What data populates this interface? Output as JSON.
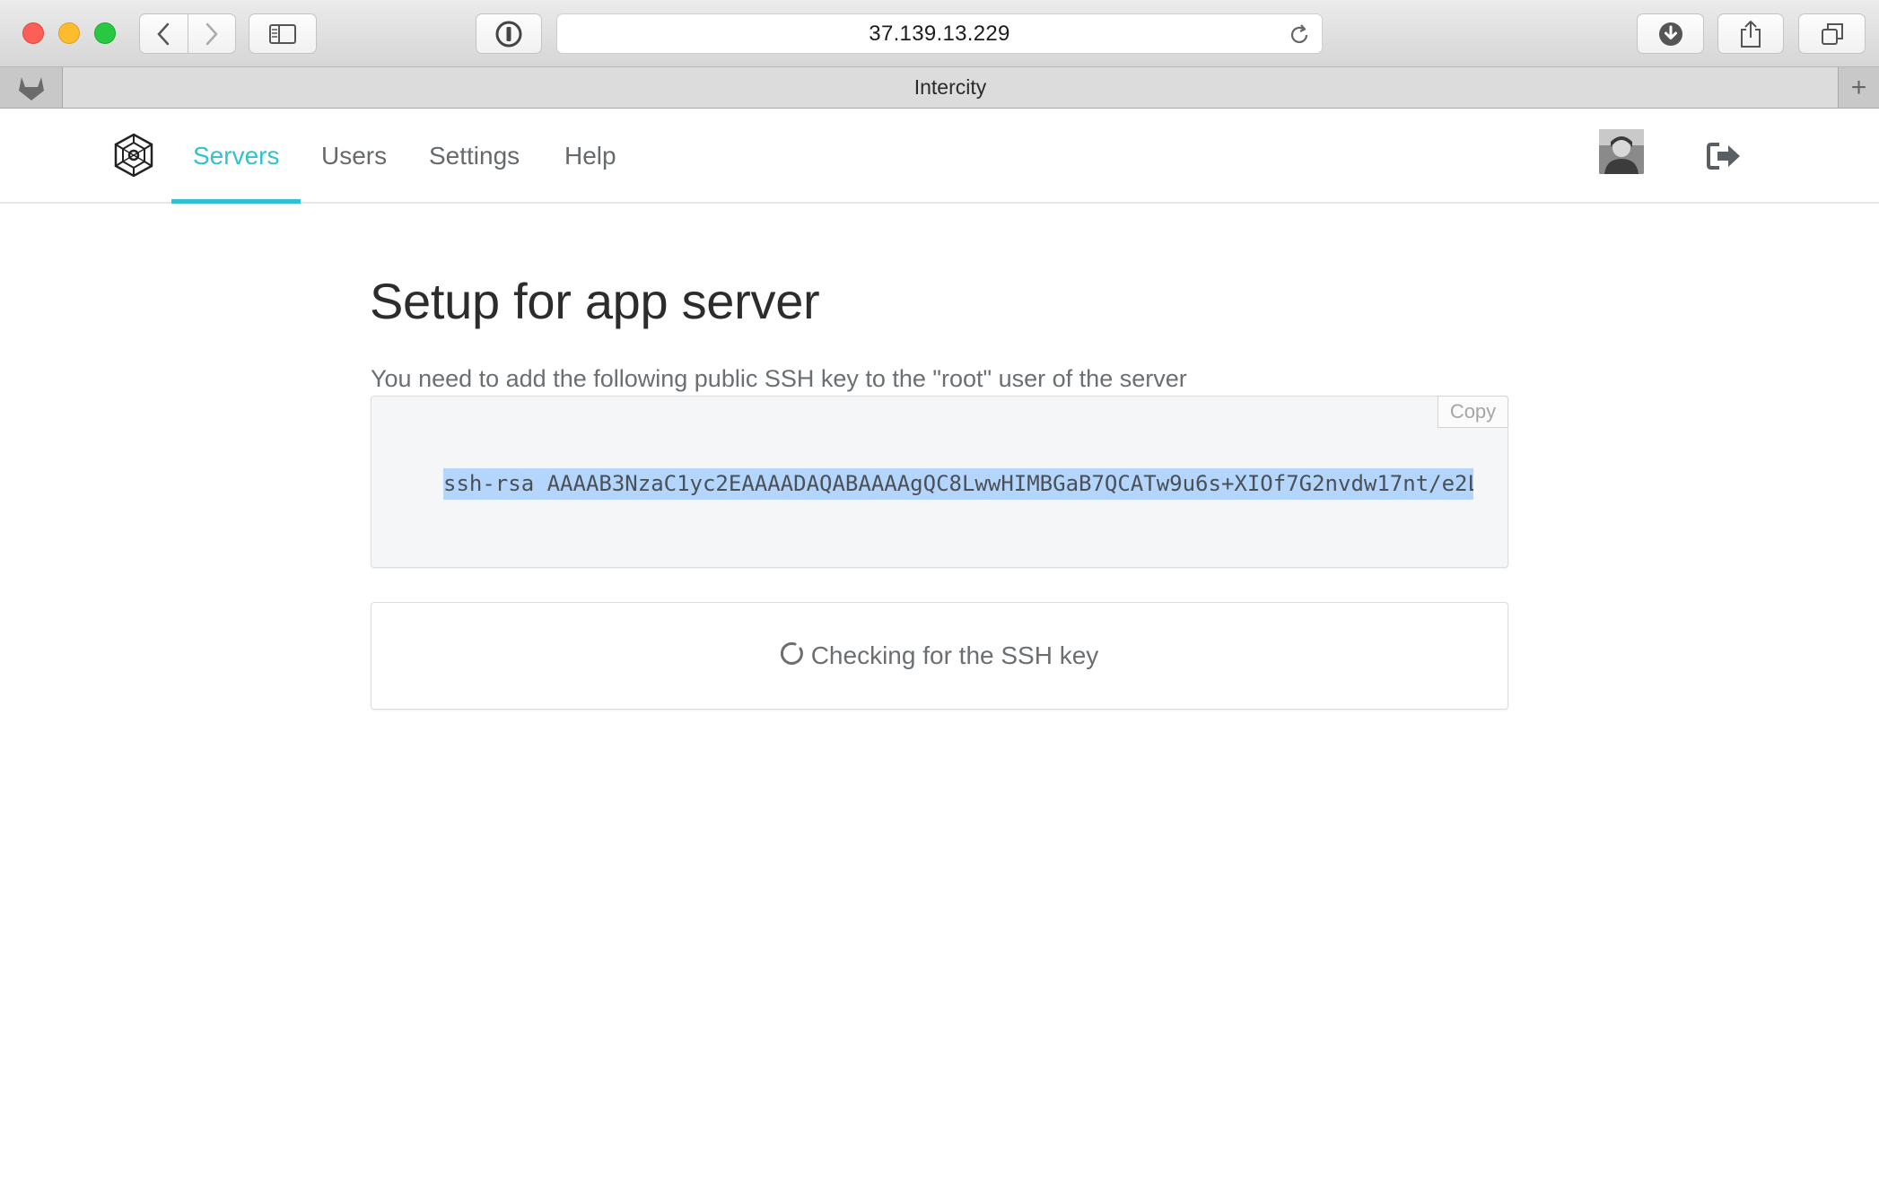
{
  "browser": {
    "url": "37.139.13.229",
    "tab_title": "Intercity",
    "new_tab_label": "+"
  },
  "nav": {
    "items": [
      {
        "label": "Servers",
        "active": true
      },
      {
        "label": "Users",
        "active": false
      },
      {
        "label": "Settings",
        "active": false
      },
      {
        "label": "Help",
        "active": false
      }
    ],
    "accent_color": "#33c1d1"
  },
  "main": {
    "title": "Setup for app server",
    "instructions": "You need to add the following public SSH key to the \"root\" user of the server",
    "copy_label": "Copy",
    "ssh_key": "ssh-rsa AAAAB3NzaC1yc2EAAAADAQABAAAAgQC8LwwHIMBGaB7QCATw9u6s+XIOf7G2nvdw17nt/e2L",
    "status_text": "Checking for the SSH key"
  },
  "icons": {
    "app_logo": "intercity-logo-icon",
    "favicon": "gitlab-fox-icon",
    "logout": "sign-out-icon"
  }
}
